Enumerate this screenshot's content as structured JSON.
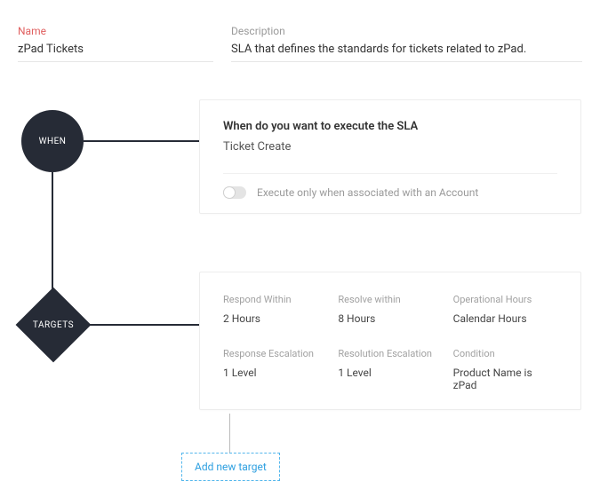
{
  "header": {
    "name_label": "Name",
    "name_value": "zPad Tickets",
    "desc_label": "Description",
    "desc_value": "SLA that defines the standards for tickets related to zPad."
  },
  "nodes": {
    "when_label": "WHEN",
    "targets_label": "TARGETS"
  },
  "when_card": {
    "title": "When do you want to execute the SLA",
    "value": "Ticket Create",
    "toggle_label": "Execute only when associated with an Account",
    "toggle_on": false
  },
  "targets_card": [
    {
      "label": "Respond Within",
      "value": "2 Hours"
    },
    {
      "label": "Resolve within",
      "value": "8 Hours"
    },
    {
      "label": "Operational Hours",
      "value": "Calendar Hours"
    },
    {
      "label": "Response Escalation",
      "value": "1 Level"
    },
    {
      "label": "Resolution Escalation",
      "value": "1 Level"
    },
    {
      "label": "Condition",
      "value": "Product Name is zPad"
    }
  ],
  "add_link": "Add new target"
}
